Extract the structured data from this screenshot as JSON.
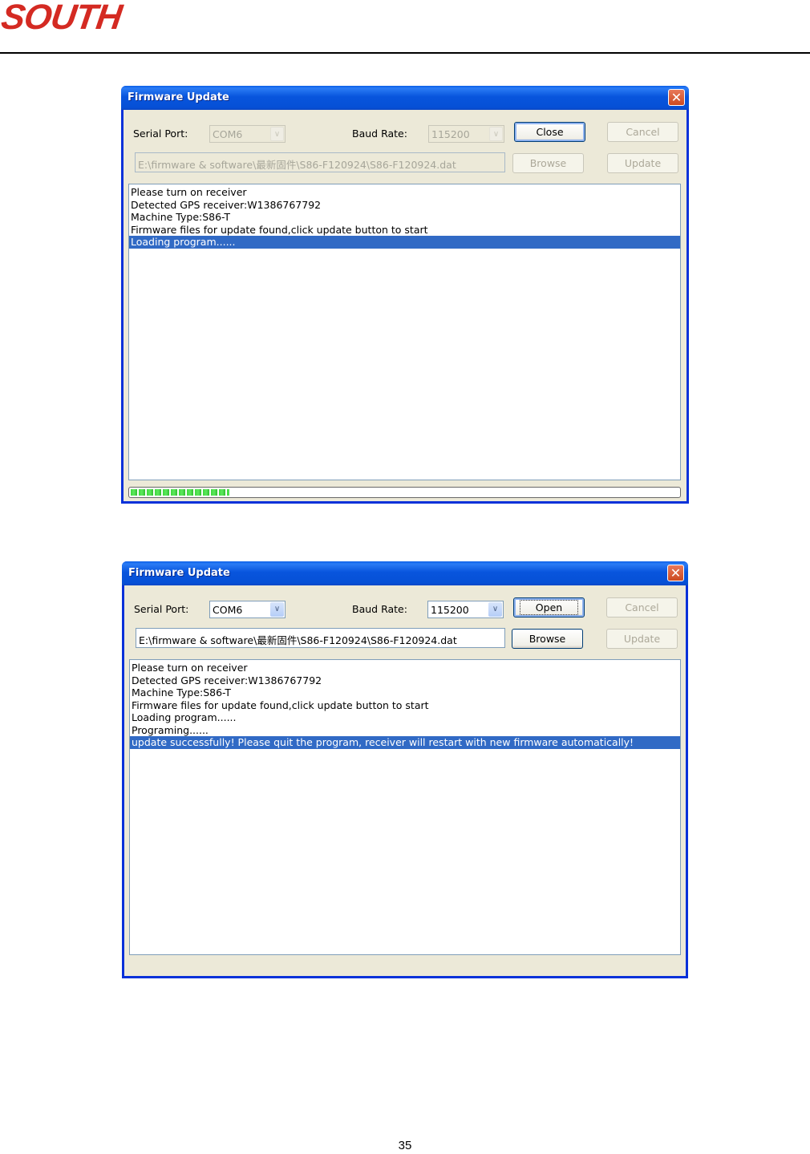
{
  "header": {
    "logo_text": "SOUTH",
    "brand_color": "#d42a22"
  },
  "page_number": "35",
  "dialogs": [
    {
      "title": "Firmware Update",
      "serial_port_label": "Serial Port:",
      "serial_port_value": "COM6",
      "serial_port_enabled": false,
      "baud_rate_label": "Baud Rate:",
      "baud_rate_value": "115200",
      "baud_rate_enabled": false,
      "file_path": "E:\\firmware & software\\最新固件\\S86-F120924\\S86-F120924.dat",
      "buttons": {
        "open_close": "Close",
        "cancel": "Cancel",
        "browse": "Browse",
        "update": "Update"
      },
      "log_lines": [
        "Please turn on receiver",
        "Detected GPS receiver:W1386767792",
        "Machine Type:S86-T",
        "Firmware files for update found,click update button to start",
        "Loading program......"
      ],
      "selected_line_index": 4,
      "progress_percent": 18
    },
    {
      "title": "Firmware Update",
      "serial_port_label": "Serial Port:",
      "serial_port_value": "COM6",
      "serial_port_enabled": true,
      "baud_rate_label": "Baud Rate:",
      "baud_rate_value": "115200",
      "baud_rate_enabled": true,
      "file_path": "E:\\firmware & software\\最新固件\\S86-F120924\\S86-F120924.dat",
      "buttons": {
        "open_close": "Open",
        "cancel": "Cancel",
        "browse": "Browse",
        "update": "Update"
      },
      "log_lines": [
        "Please turn on receiver",
        "Detected GPS receiver:W1386767792",
        "Machine Type:S86-T",
        "Firmware files for update found,click update button to start",
        "Loading program......",
        "Programing......",
        "update successfully! Please quit the program, receiver will restart with new firmware automatically!"
      ],
      "selected_line_index": 6
    }
  ]
}
